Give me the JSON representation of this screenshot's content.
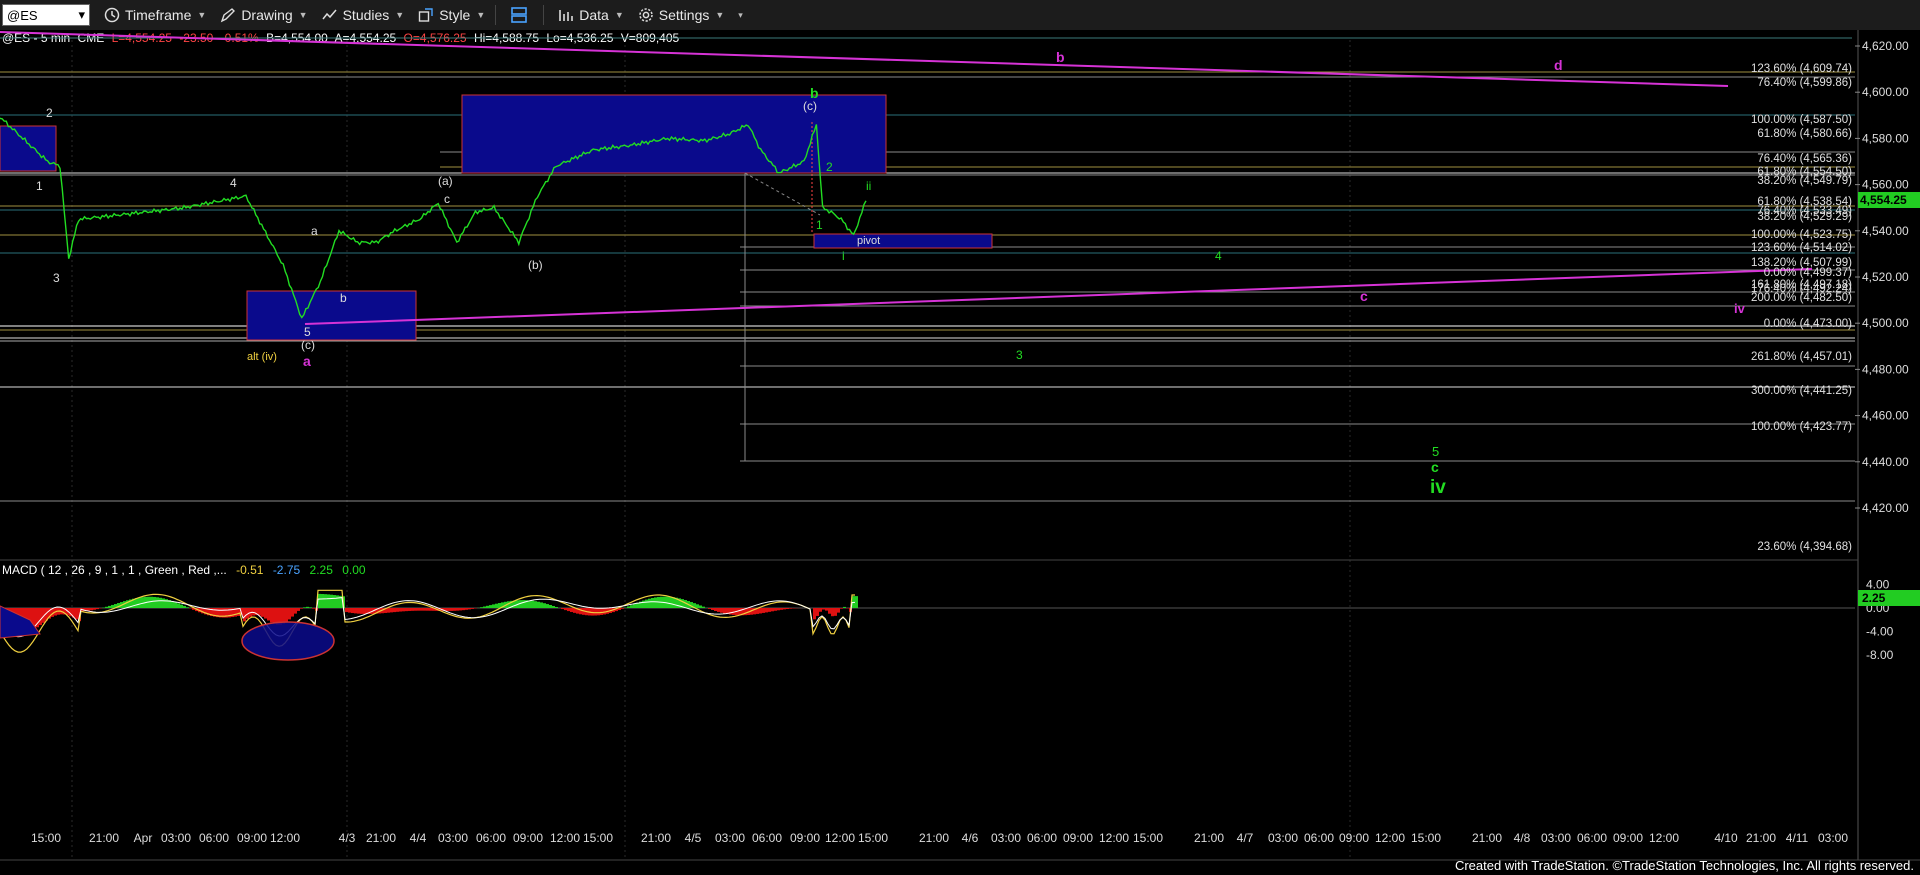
{
  "toolbar": {
    "symbol": "@ES",
    "timeframe": "Timeframe",
    "drawing": "Drawing",
    "studies": "Studies",
    "style": "Style",
    "data": "Data",
    "settings": "Settings"
  },
  "header": {
    "symbol": "@ES - 5 min",
    "exchange": "CME",
    "last": "L=4,554.25",
    "change": "-23.50",
    "pct": "-0.51%",
    "bid": "B=4,554.00",
    "ask": "A=4,554.25",
    "open": "O=4,576.25",
    "high": "Hi=4,588.75",
    "low": "Lo=4,536.25",
    "volume": "V=809,405"
  },
  "price_axis": {
    "ticks": [
      "4,620.00",
      "4,600.00",
      "4,580.00",
      "4,560.00",
      "4,540.00",
      "4,520.00",
      "4,500.00",
      "4,480.00",
      "4,460.00",
      "4,440.00",
      "4,420.00"
    ],
    "current": "4,554.25"
  },
  "macd": {
    "title": "MACD ( 12 , 26 , 9 , 1 , 1 , Green , Red ,...",
    "v1": "-0.51",
    "v2": "-2.75",
    "v3": "2.25",
    "v4": "0.00",
    "ticks": [
      "4.00",
      "0.00",
      "-4.00",
      "-8.00"
    ],
    "current": "2.25"
  },
  "time_axis": [
    "15:00",
    "21:00",
    "Apr",
    "03:00",
    "06:00",
    "09:00",
    "12:00",
    "4/3",
    "21:00",
    "4/4",
    "03:00",
    "06:00",
    "09:00",
    "12:00",
    "15:00",
    "21:00",
    "4/5",
    "03:00",
    "06:00",
    "09:00",
    "12:00",
    "15:00",
    "21:00",
    "4/6",
    "03:00",
    "06:00",
    "09:00",
    "12:00",
    "15:00",
    "21:00",
    "4/7",
    "03:00",
    "06:00",
    "09:00",
    "12:00",
    "15:00",
    "21:00",
    "4/8",
    "03:00",
    "06:00",
    "09:00",
    "12:00",
    "4/10",
    "21:00",
    "4/11",
    "03:00"
  ],
  "fib_labels": [
    "123.60% (4,609.74)",
    "76.40% (4,599.86)",
    "100.00% (4,587.50)",
    "61.80% (4,580.66)",
    "76.40% (4,565.36)",
    "61.80% (4,554.50)",
    "38.20% (4,549.79)",
    "61.80% (4,538.54)",
    "76.40% (4,533.49)",
    "38.20% (4,529.29)",
    "100.00% (4,523.75)",
    "123.60% (4,514.02)",
    "138.20% (4,507.99)",
    "0.00% (4,499.37)",
    "161.80% (4,497.18)",
    "176.40% (4,492.24)",
    "200.00% (4,482.50)",
    "0.00% (4,473.00)",
    "261.80% (4,457.01)",
    "300.00% (4,441.25)",
    "100.00% (4,423.77)",
    "23.60% (4,394.68)"
  ],
  "wave_labels": {
    "w2": "2",
    "w1": "1",
    "w3": "3",
    "w4": "4",
    "a_small": "a",
    "b_small": "b",
    "five": "5",
    "c_paren_low": "(c)",
    "alt_iv": "alt (iv)",
    "a_magenta": "a",
    "a_paren": "(a)",
    "c_small": "c",
    "b_paren": "(b)",
    "c_paren_top": "(c)",
    "b_green": "b",
    "g2": "2",
    "g1": "1",
    "ii": "ii",
    "i": "i",
    "pivot": "pivot",
    "b_magenta": "b",
    "d_magenta": "d",
    "c_magenta": "c",
    "iv_magenta": "iv",
    "g4": "4",
    "g3": "3",
    "g5": "5",
    "gc": "c",
    "giv": "iv"
  },
  "colors": {
    "price": "#22dd22",
    "magenta": "#d633d6",
    "box_fill": "#0a0a8c",
    "box_border": "#cc3333",
    "fib_line": "#8a8a8a",
    "fib_gold": "#a09040",
    "macd_pos": "#22cc22",
    "macd_neg": "#dd1111"
  },
  "footer": "Created with TradeStation. ©TradeStation Technologies, Inc. All rights reserved.",
  "chart_data": {
    "type": "line",
    "series": [
      {
        "x": [
          0,
          20,
          40,
          50,
          57,
          65,
          100,
          150,
          200,
          230,
          245,
          260,
          275,
          290,
          305,
          320,
          340,
          355,
          370,
          385,
          400,
          420,
          435,
          450,
          480,
          510,
          540,
          570,
          590,
          605,
          615,
          630,
          650,
          660,
          665,
          672,
          680,
          690,
          700
        ],
        "y": [
          4590,
          4580,
          4570,
          4568,
          4528,
          4545,
          4547,
          4550,
          4555,
          4525,
          4502,
          4518,
          4540,
          4535,
          4535,
          4540,
          4545,
          4552,
          4535,
          4548,
          4550,
          4535,
          4555,
          4568,
          4575,
          4577,
          4580,
          4579,
          4582,
          4586,
          4575,
          4565,
          4570,
          4586,
          4550,
          4548,
          4545,
          4538,
          4553
        ]
      }
    ],
    "ylim": [
      4385,
      4625
    ],
    "macd_ylim": [
      -9,
      5
    ]
  }
}
